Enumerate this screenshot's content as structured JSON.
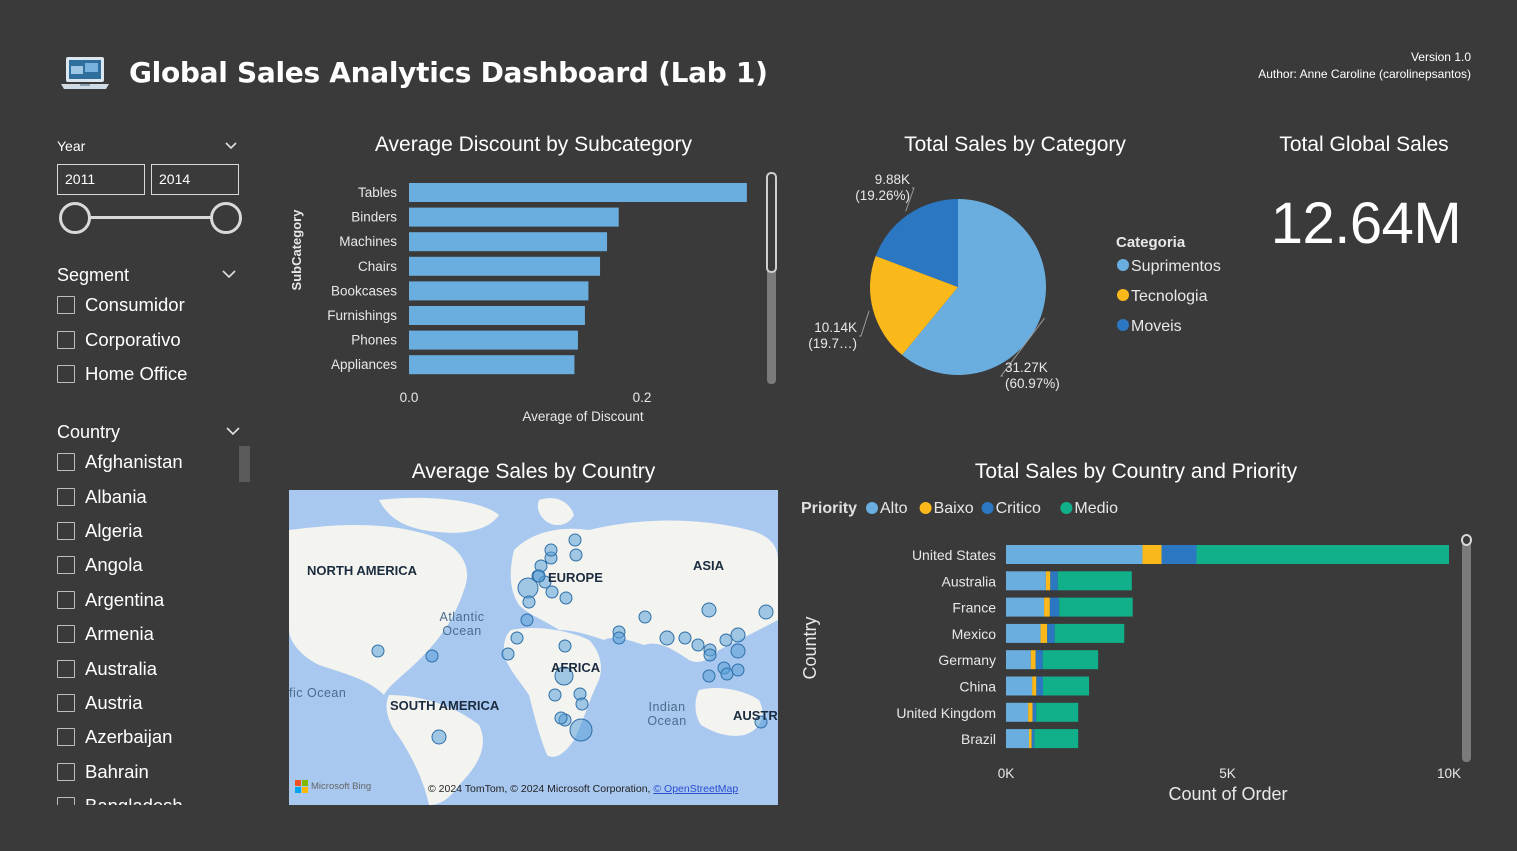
{
  "header": {
    "title": "Global Sales Analytics Dashboard (Lab 1)",
    "version": "Version 1.0",
    "author": "Author: Anne Caroline (carolinepsantos)",
    "logo_icon": "laptop-icon"
  },
  "filters": {
    "year": {
      "label": "Year",
      "from": "2011",
      "to": "2014"
    },
    "segment": {
      "label": "Segment",
      "options": [
        "Consumidor",
        "Corporativo",
        "Home Office"
      ]
    },
    "country": {
      "label": "Country",
      "options": [
        "Afghanistan",
        "Albania",
        "Algeria",
        "Angola",
        "Argentina",
        "Armenia",
        "Australia",
        "Austria",
        "Azerbaijan",
        "Bahrain",
        "Bangladesh"
      ]
    }
  },
  "kpi": {
    "title": "Total Global Sales",
    "value": "12.64M"
  },
  "map": {
    "title": "Average Sales by Country",
    "labels": {
      "north_america": "NORTH AMERICA",
      "europe": "EUROPE",
      "asia": "ASIA",
      "atlantic": "Atlantic\nOcean",
      "pacific": "fic Ocean",
      "africa": "AFRICA",
      "south_america": "SOUTH AMERICA",
      "indian": "Indian\nOcean",
      "australia": "AUSTR"
    },
    "bing": "Microsoft Bing",
    "copyright": "© 2024 TomTom, © 2024 Microsoft Corporation,",
    "osm_link": "© OpenStreetMap"
  },
  "colors": {
    "light_blue": "#6aaee0",
    "yellow": "#fbb81b",
    "dark_blue": "#2b77c2",
    "teal": "#11b08a",
    "background": "#3a3a3a"
  },
  "chart_data": [
    {
      "type": "bar",
      "orientation": "horizontal",
      "title": "Average Discount by Subcategory",
      "xlabel": "Average of Discount",
      "ylabel": "SubCategory",
      "categories": [
        "Tables",
        "Binders",
        "Machines",
        "Chairs",
        "Bookcases",
        "Furnishings",
        "Phones",
        "Appliances"
      ],
      "values": [
        0.29,
        0.18,
        0.17,
        0.164,
        0.154,
        0.151,
        0.145,
        0.142
      ],
      "xticks": [
        "0.0",
        "0.2"
      ],
      "xlim": [
        0,
        0.3
      ]
    },
    {
      "type": "pie",
      "title": "Total Sales by Category",
      "legend_title": "Categoria",
      "legend_position": "right",
      "slices": [
        {
          "name": "Suprimentos",
          "value": 31270,
          "label": "31.27K",
          "pct": "(60.97%)",
          "color": "#6aaee0"
        },
        {
          "name": "Tecnologia",
          "value": 10140,
          "label": "10.14K",
          "pct": "(19.7…)",
          "color": "#fbb81b"
        },
        {
          "name": "Moveis",
          "value": 9880,
          "label": "9.88K",
          "pct": "(19.26%)",
          "color": "#2b77c2"
        }
      ]
    },
    {
      "type": "bar",
      "orientation": "horizontal",
      "stacked": true,
      "title": "Total Sales by Country and Priority",
      "xlabel": "Count of Order",
      "ylabel": "Country",
      "legend_title": "Priority",
      "legend_position": "top-left",
      "categories": [
        "United States",
        "Australia",
        "France",
        "Mexico",
        "Germany",
        "China",
        "United Kingdom",
        "Brazil"
      ],
      "series": [
        {
          "name": "Alto",
          "color": "#6aaee0",
          "values": [
            3080,
            900,
            860,
            780,
            560,
            590,
            500,
            520
          ]
        },
        {
          "name": "Baixo",
          "color": "#fbb81b",
          "values": [
            430,
            100,
            130,
            150,
            110,
            95,
            100,
            60
          ]
        },
        {
          "name": "Critico",
          "color": "#2b77c2",
          "values": [
            790,
            170,
            210,
            170,
            160,
            150,
            80,
            60
          ]
        },
        {
          "name": "Medio",
          "color": "#11b08a",
          "values": [
            5700,
            1670,
            1660,
            1570,
            1250,
            1040,
            950,
            990
          ]
        }
      ],
      "xticks": [
        "0K",
        "5K",
        "10K"
      ],
      "xlim": [
        0,
        10000
      ]
    }
  ]
}
